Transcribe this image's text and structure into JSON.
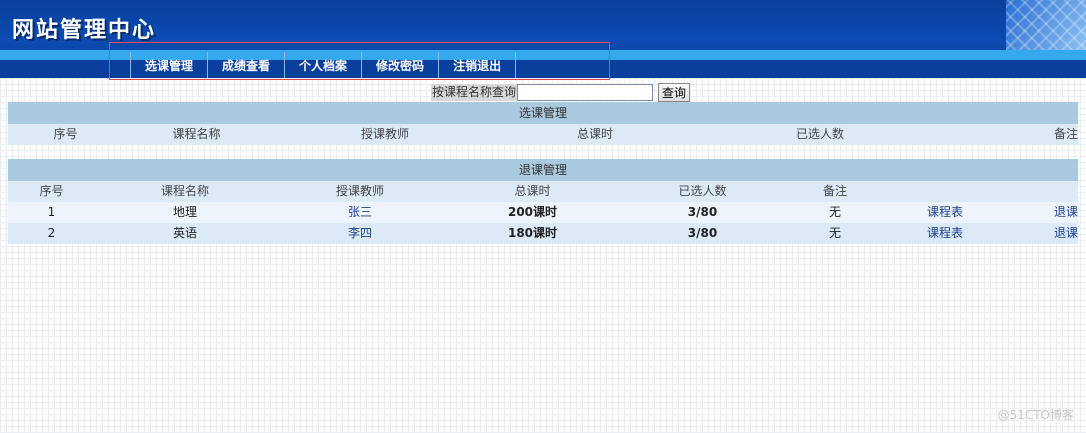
{
  "header": {
    "site_title": "网站管理中心"
  },
  "nav": {
    "items": [
      {
        "label": "选课管理"
      },
      {
        "label": "成绩查看"
      },
      {
        "label": "个人档案"
      },
      {
        "label": "修改密码"
      },
      {
        "label": "注销退出"
      }
    ]
  },
  "search": {
    "label": "按课程名称查询",
    "value": "",
    "button_label": "查询"
  },
  "select_table": {
    "title": "选课管理",
    "columns": [
      "序号",
      "课程名称",
      "授课教师",
      "总课时",
      "已选人数",
      "备注"
    ],
    "rows": []
  },
  "drop_table": {
    "title": "退课管理",
    "columns": [
      "序号",
      "课程名称",
      "授课教师",
      "总课时",
      "已选人数",
      "备注",
      "",
      ""
    ],
    "rows": [
      {
        "no": "1",
        "course": "地理",
        "teacher": "张三",
        "hours": "200课时",
        "selected": "3/80",
        "note": "无",
        "schedule": "课程表",
        "action": "退课"
      },
      {
        "no": "2",
        "course": "英语",
        "teacher": "李四",
        "hours": "180课时",
        "selected": "3/80",
        "note": "无",
        "schedule": "课程表",
        "action": "退课"
      }
    ]
  },
  "watermark": "@51CTO博客"
}
